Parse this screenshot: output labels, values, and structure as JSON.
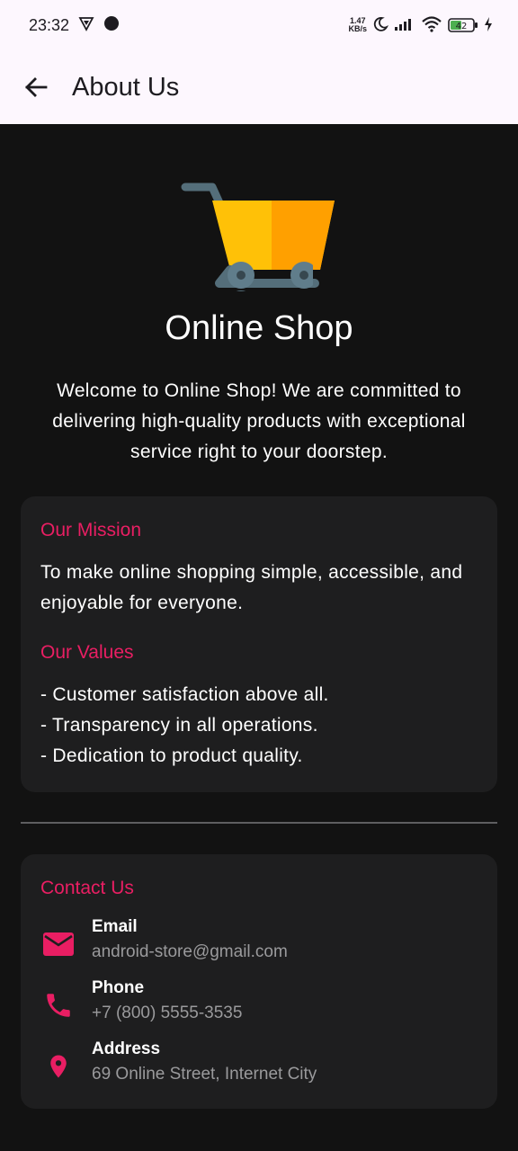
{
  "status_bar": {
    "time": "23:32",
    "net_speed_value": "1.47",
    "net_speed_unit": "KB/s",
    "battery": "42"
  },
  "app_bar": {
    "title": "About Us"
  },
  "header": {
    "shop_name": "Online Shop",
    "welcome_text": "Welcome to Online Shop! We are committed to delivering high-quality products with exceptional service right to your doorstep."
  },
  "mission": {
    "title": "Our Mission",
    "text": "To make online shopping simple, accessible, and enjoyable for everyone."
  },
  "values": {
    "title": "Our Values",
    "items": [
      "- Customer satisfaction above all.",
      "- Transparency in all operations.",
      "- Dedication to product quality."
    ]
  },
  "contact": {
    "title": "Contact Us",
    "items": [
      {
        "label": "Email",
        "value": "android-store@gmail.com",
        "icon": "email-icon"
      },
      {
        "label": "Phone",
        "value": "+7 (800) 5555-3535",
        "icon": "phone-icon"
      },
      {
        "label": "Address",
        "value": "69 Online Street, Internet City",
        "icon": "location-pin-icon"
      }
    ]
  },
  "colors": {
    "accent": "#e91e63",
    "background": "#121212",
    "card": "#1e1e1f",
    "app_bar": "#fdf7fe"
  }
}
